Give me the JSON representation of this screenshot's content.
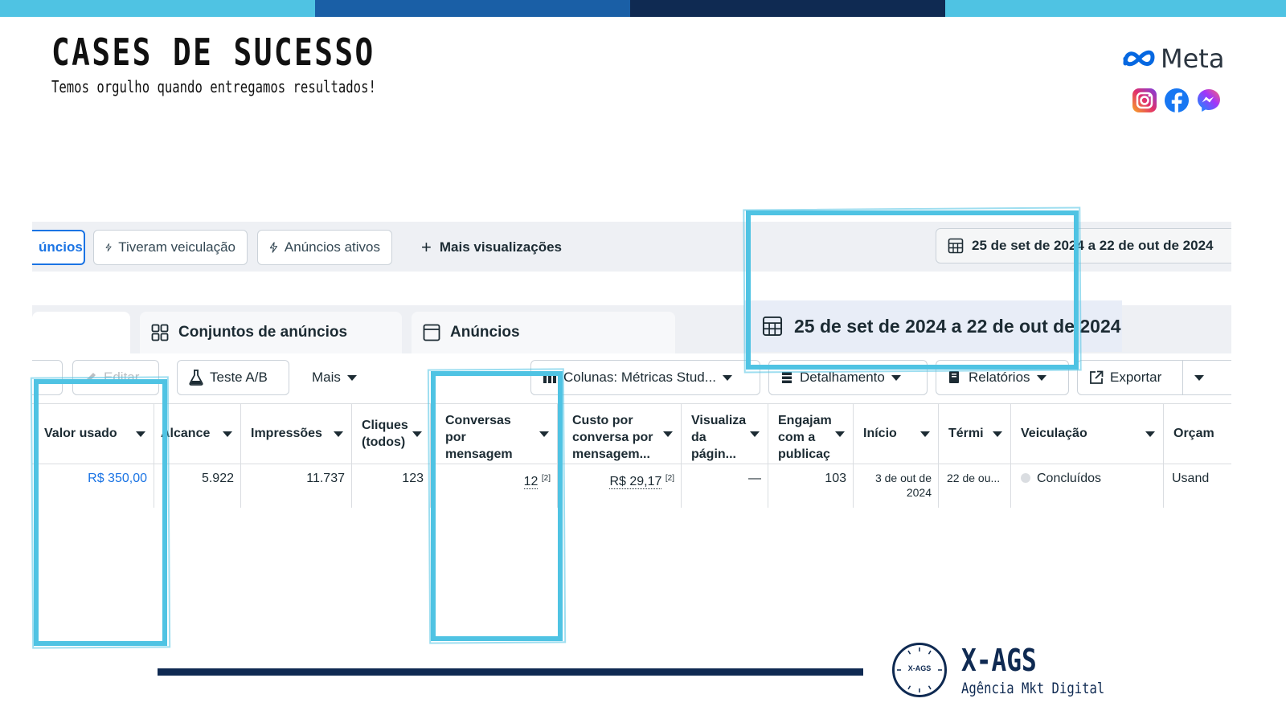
{
  "colors": {
    "stripe_light": "#4fc3e3",
    "stripe_mid": "#1a5fa6",
    "stripe_dark": "#0f2a52",
    "highlight": "#4fc3e3",
    "link_blue": "#1b74e4"
  },
  "header": {
    "title": "CASES DE SUCESSO",
    "subtitle": "Temos orgulho quando entregamos resultados!"
  },
  "meta": {
    "wordmark": "Meta",
    "icons": [
      "instagram-icon",
      "facebook-icon",
      "messenger-icon"
    ]
  },
  "views_bar": {
    "active_chip": "úncios",
    "chips": [
      "Tiveram veiculação",
      "Anúncios ativos"
    ],
    "more_views": "Mais visualizações",
    "date_range": "25 de set de 2024 a 22 de out de 2024"
  },
  "tabs": [
    {
      "label": "Conjuntos de anúncios",
      "icon": "grid-icon"
    },
    {
      "label": "Anúncios",
      "icon": "window-icon"
    }
  ],
  "date_callout": "25 de set de 2024 a 22 de out de 2024",
  "toolbar": {
    "edit": "Editar",
    "ab_test": "Teste A/B",
    "more": "Mais",
    "columns": "Colunas: Métricas Stud...",
    "breakdown": "Detalhamento",
    "reports": "Relatórios",
    "export": "Exportar"
  },
  "table": {
    "columns": [
      "Valor usado",
      "Alcance",
      "Impressões",
      "Cliques (todos)",
      "Conversas por mensagem iniciadas",
      "Custo por conversa por mensagem...",
      "Visualiza da págin...",
      "Engajam com a publicaç",
      "Início",
      "Térmi",
      "Veiculação",
      "Orçam"
    ],
    "row": {
      "spent": "R$ 350,00",
      "reach": "5.922",
      "impressions": "11.737",
      "clicks": "123",
      "conversations": "12",
      "conversations_note": "[2]",
      "cost_per_conversation": "R$ 29,17",
      "cost_note": "[2]",
      "page_views": "—",
      "engagement": "103",
      "start": "3 de out de 2024",
      "end": "22 de ou...",
      "delivery": "Concluídos",
      "budget": "Usand"
    }
  },
  "footer": {
    "logo_text": "X-AGS",
    "brand": "X-AGS",
    "tagline": "Agência Mkt Digital"
  }
}
